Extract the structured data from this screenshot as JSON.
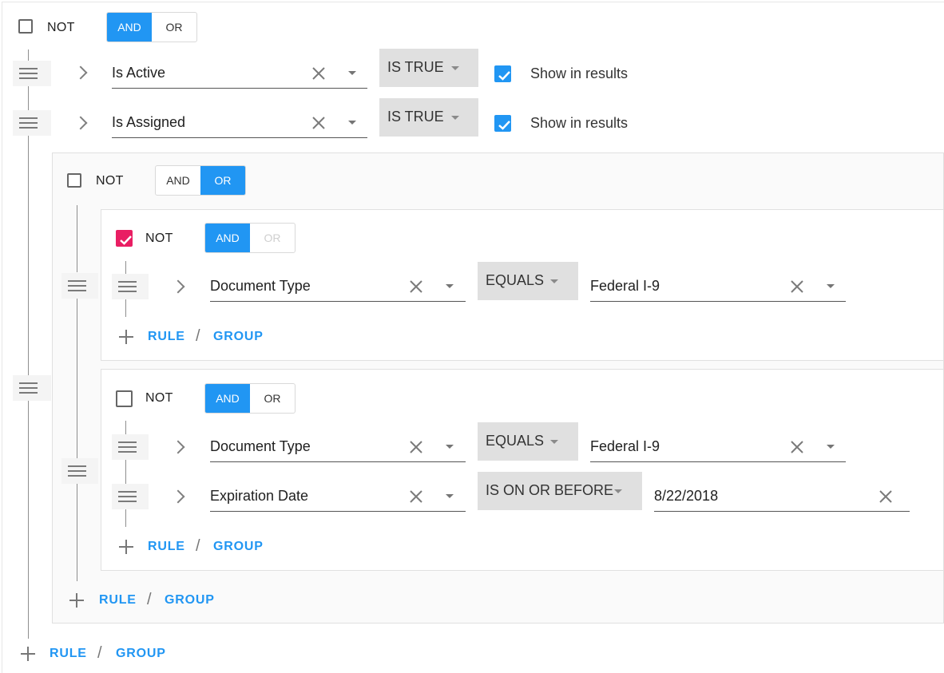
{
  "colors": {
    "accent": "#2196f3",
    "checked_red": "#e91e63"
  },
  "labels": {
    "not": "NOT",
    "and": "AND",
    "or": "OR",
    "rule": "RULE",
    "group": "GROUP",
    "slash": "/",
    "show_in_results": "Show in results"
  },
  "root": {
    "not_checked": false,
    "combinator": "AND",
    "rules": [
      {
        "field": "Is Active",
        "operator": "IS TRUE",
        "show_in_results": true
      },
      {
        "field": "Is Assigned",
        "operator": "IS TRUE",
        "show_in_results": true
      }
    ],
    "group": {
      "not_checked": false,
      "combinator": "OR",
      "groups": [
        {
          "not_checked": true,
          "combinator": "AND",
          "or_disabled": true,
          "rules": [
            {
              "field": "Document Type",
              "operator": "EQUALS",
              "value": "Federal I-9"
            }
          ]
        },
        {
          "not_checked": false,
          "combinator": "AND",
          "rules": [
            {
              "field": "Document Type",
              "operator": "EQUALS",
              "value": "Federal I-9"
            },
            {
              "field": "Expiration Date",
              "operator": "IS ON OR BEFORE",
              "value": "8/22/2018"
            }
          ]
        }
      ]
    }
  },
  "icons": [
    "drag-handle-icon",
    "chevron-right-icon",
    "close-icon",
    "dropdown-caret-icon",
    "check-icon",
    "plus-icon"
  ]
}
